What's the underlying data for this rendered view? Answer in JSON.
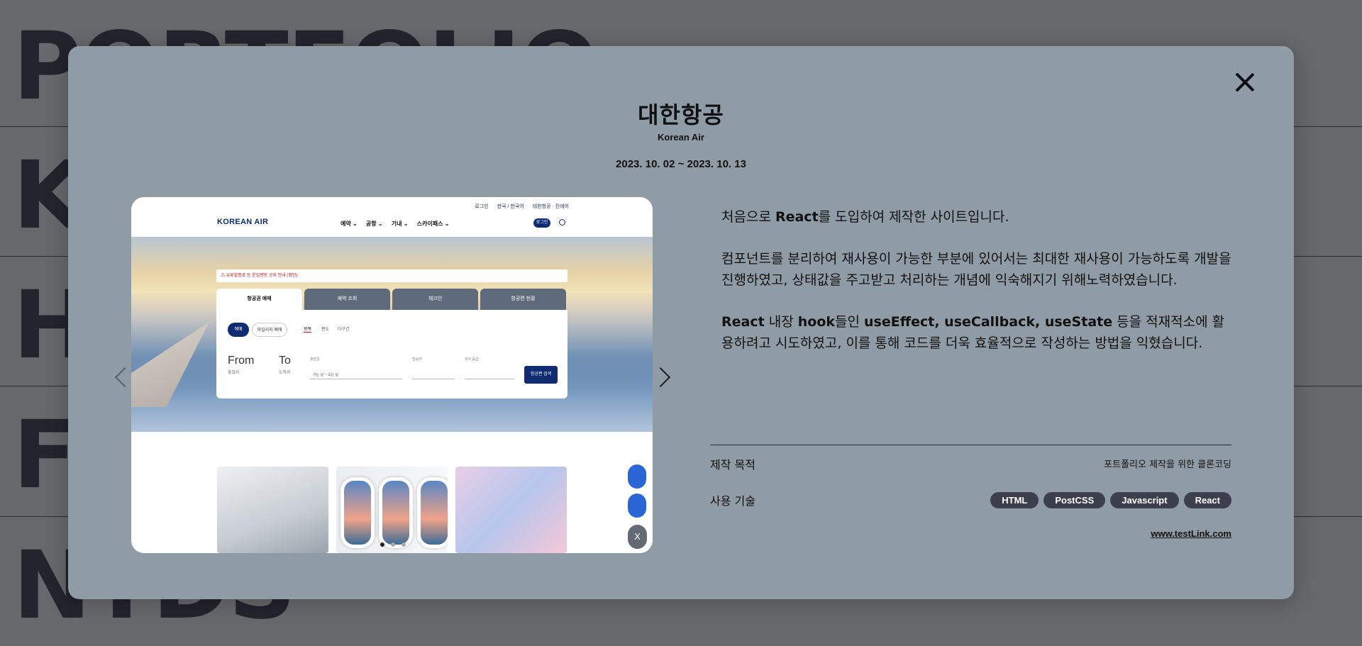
{
  "background": {
    "words": [
      "PORTFOLIO",
      "K",
      "H",
      "F",
      "NTDS"
    ]
  },
  "modal": {
    "title": "대한항공",
    "subtitle": "Korean Air",
    "period": "2023. 10. 02 ~ 2023. 10. 13",
    "close_icon": "close-icon",
    "preview": {
      "top_links": [
        "로그인",
        "한국 / 한국어",
        "대한항공 · 진에어"
      ],
      "logo": "KOREAN AIR",
      "menu": [
        "예약 ⌄",
        "공항 ⌄",
        "기내 ⌄",
        "스카이패스 ⌄"
      ],
      "login": "로그인",
      "alert": "⚠ 유류할증료 등 운임변동 공지 안내 (확인)",
      "tabs": [
        "항공권 예매",
        "예약 조회",
        "체크인",
        "항공편 현황"
      ],
      "pills": [
        "예매",
        "마일리지 예매"
      ],
      "subtabs": [
        "왕복",
        "편도",
        "다구간"
      ],
      "from": "From",
      "from_sub": "출발지",
      "to": "To",
      "to_sub": "도착지",
      "field_date": "출발일",
      "field_date_value": "가는 날 ~ 오는 날",
      "field_pax": "탑승객",
      "field_class": "좌석 등급",
      "find_button": "항공편 검색",
      "side_close": "X"
    },
    "description": {
      "p1_a": "처음으로 ",
      "p1_b": "React",
      "p1_c": "를 도입하여 제작한 사이트입니다.",
      "p2": "컴포넌트를 분리하여 재사용이 가능한 부분에 있어서는 최대한 재사용이 가능하도록 개발을 진행하였고, 상태값을 주고받고 처리하는 개념에 익숙해지기 위해노력하였습니다.",
      "p3_a": "React",
      "p3_b": " 내장 ",
      "p3_c": "hook",
      "p3_d": "들인 ",
      "p3_e": "useEffect, useCallback, useState",
      "p3_f": " 등을 적재적소에 활용하려고 시도하였고, 이를 통해 코드를 더욱 효율적으로 작성하는 방법을 익혔습니다."
    },
    "info": {
      "purpose_label": "제작 목적",
      "purpose_value": "포트폴리오 제작을 위한 클론코딩",
      "tech_label": "사용 기술",
      "tags": [
        "HTML",
        "PostCSS",
        "Javascript",
        "React"
      ],
      "link": "www.testLink.com"
    }
  }
}
